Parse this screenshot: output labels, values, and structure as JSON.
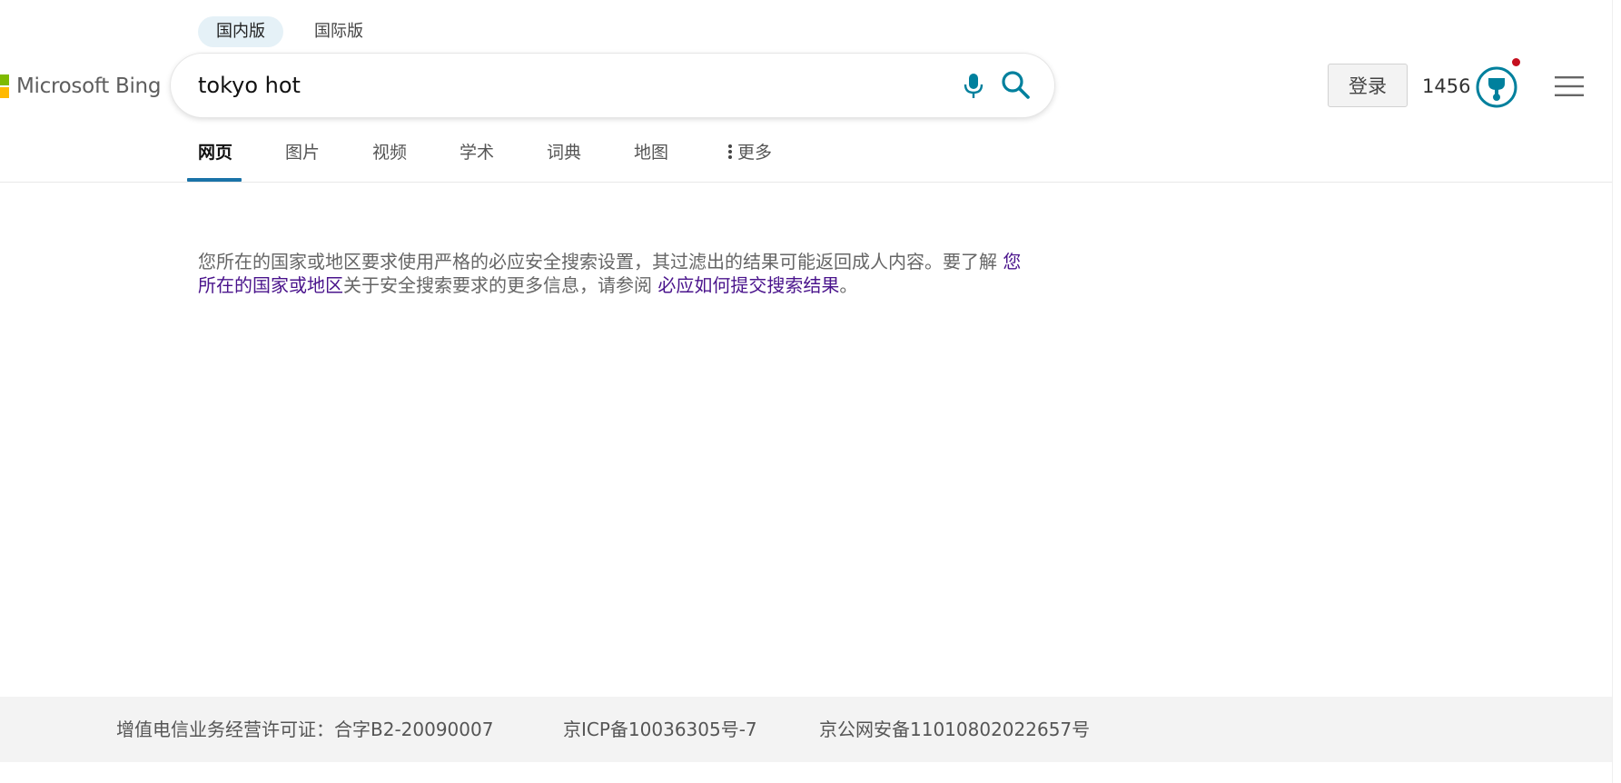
{
  "editions": [
    {
      "label": "国内版",
      "active": true
    },
    {
      "label": "国际版",
      "active": false
    }
  ],
  "logo": {
    "text": "Microsoft Bing"
  },
  "search": {
    "value": "tokyo hot",
    "mic_icon": "microphone-icon",
    "search_icon": "search-icon"
  },
  "header": {
    "login_label": "登录",
    "points": "1456",
    "rewards_icon": "rewards-trophy-icon",
    "menu_icon": "hamburger-menu-icon"
  },
  "nav": {
    "items": [
      {
        "label": "网页",
        "active": true
      },
      {
        "label": "图片"
      },
      {
        "label": "视频"
      },
      {
        "label": "学术"
      },
      {
        "label": "词典"
      },
      {
        "label": "地图"
      },
      {
        "label": "更多"
      }
    ]
  },
  "notice": {
    "text1": "您所在的国家或地区要求使用严格的必应安全搜索设置，其过滤出的结果可能返回成人内容。要了解 ",
    "link1": "您所在的国家或地区",
    "text2": "关于安全搜索要求的更多信息，请参阅 ",
    "link2": "必应如何提交搜索结果",
    "text3": "。"
  },
  "footer": {
    "license": "增值电信业务经营许可证：合字B2-20090007",
    "icp": "京ICP备10036305号-7",
    "police": "京公网安备11010802022657号"
  },
  "colors": {
    "accent": "#1a73a8",
    "icon_teal": "#00809d",
    "link": "#4a148c",
    "notification": "#c50f1f"
  }
}
